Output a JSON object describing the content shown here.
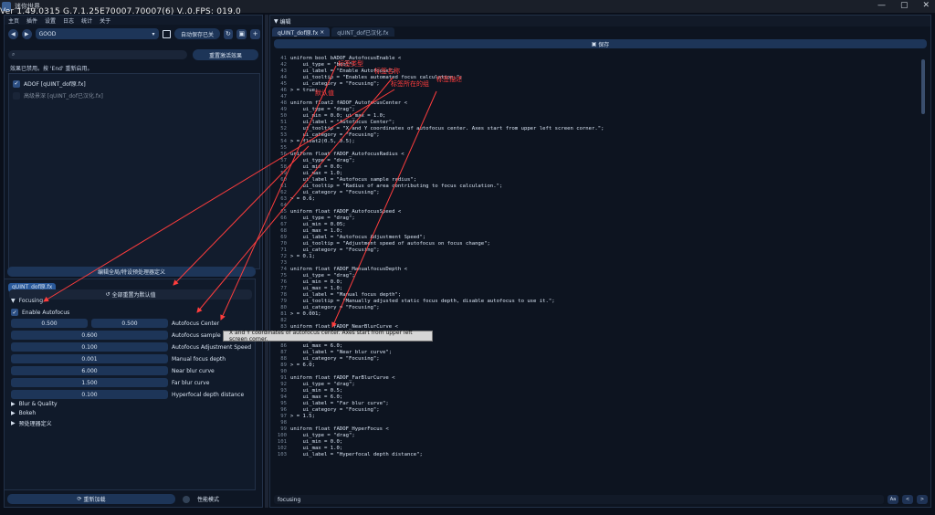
{
  "window": {
    "title": "迷你世界",
    "version_overlay": "Ver 1.49.0315 G.7.1.25E70007.70007(6) V..0.FPS: 019.0"
  },
  "left": {
    "menu": [
      "主页",
      "插件",
      "设置",
      "日志",
      "统计",
      "关于"
    ],
    "preset": {
      "value": "GOOD"
    },
    "autosave_label": "自动保存已关",
    "search_placeholder": "",
    "rearrange_label": "重置激活效果",
    "hint": "效果已禁用。按 'End' 重新启用。",
    "effects": [
      {
        "label": "ADOF [qUINT_dof原.fx]",
        "checked": true
      },
      {
        "label": "高级景深 [qUINT_dof已汉化.fx]",
        "checked": false
      }
    ],
    "editor_toggle_label": "编辑全局/特设预处理器定义",
    "param_tab": "qUINT_dof原.fx",
    "reset_all_label": "全部重置为默认值",
    "sections": {
      "focusing": "Focusing",
      "enable_autofocus": "Enable Autofocus",
      "blur_quality": "Blur & Quality",
      "bokeh": "Bokeh",
      "preprocessor": "预处理器定义"
    },
    "params": [
      {
        "label": "Autofocus Center",
        "values": [
          "0.500",
          "0.500"
        ]
      },
      {
        "label": "Autofocus sample radius",
        "values": [
          "0.600"
        ]
      },
      {
        "label": "Autofocus Adjustment Speed",
        "values": [
          "0.100"
        ]
      },
      {
        "label": "Manual focus depth",
        "values": [
          "0.001"
        ]
      },
      {
        "label": "Near blur curve",
        "values": [
          "6.000"
        ]
      },
      {
        "label": "Far blur curve",
        "values": [
          "1.500"
        ]
      },
      {
        "label": "Hyperfocal depth distance",
        "values": [
          "0.100"
        ]
      }
    ],
    "reload_label": "重新加载",
    "perf_mode_label": "性能模式"
  },
  "right": {
    "title": "编辑",
    "tabs": [
      "qUINT_dof原.fx",
      "qUINT_dof已汉化.fx"
    ],
    "save_label": "保存",
    "find_value": "focusing",
    "find_buttons": [
      "Aa",
      "<",
      ">"
    ]
  },
  "code_lines": [
    {
      "n": "41",
      "t": "uniform bool bADOF_AutofocusEnable <"
    },
    {
      "n": "42",
      "t": "    ui_type = \"bool\";"
    },
    {
      "n": "43",
      "t": "    ui_label = \"Enable Autofocus\";"
    },
    {
      "n": "44",
      "t": "    ui_tooltip = \"Enables automated focus calculation.\";"
    },
    {
      "n": "45",
      "t": "    ui_category = \"Focusing\";"
    },
    {
      "n": "46",
      "t": "> = true;"
    },
    {
      "n": "47",
      "t": ""
    },
    {
      "n": "48",
      "t": "uniform float2 fADOF_AutofocusCenter <"
    },
    {
      "n": "49",
      "t": "    ui_type = \"drag\";"
    },
    {
      "n": "50",
      "t": "    ui_min = 0.0; ui_max = 1.0;"
    },
    {
      "n": "51",
      "t": "    ui_label = \"Autofocus Center\";"
    },
    {
      "n": "52",
      "t": "    ui_tooltip = \"X and Y coordinates of autofocus center. Axes start from upper left screen corner.\";"
    },
    {
      "n": "53",
      "t": "    ui_category = \"Focusing\";"
    },
    {
      "n": "54",
      "t": "> = float2(0.5, 0.5);"
    },
    {
      "n": "55",
      "t": ""
    },
    {
      "n": "56",
      "t": "uniform float fADOF_AutofocusRadius <"
    },
    {
      "n": "57",
      "t": "    ui_type = \"drag\";"
    },
    {
      "n": "58",
      "t": "    ui_min = 0.0;"
    },
    {
      "n": "59",
      "t": "    ui_max = 1.0;"
    },
    {
      "n": "60",
      "t": "    ui_label = \"Autofocus sample radius\";"
    },
    {
      "n": "61",
      "t": "    ui_tooltip = \"Radius of area contributing to focus calculation.\";"
    },
    {
      "n": "62",
      "t": "    ui_category = \"Focusing\";"
    },
    {
      "n": "63",
      "t": "> = 0.6;"
    },
    {
      "n": "64",
      "t": ""
    },
    {
      "n": "65",
      "t": "uniform float fADOF_AutofocusSpeed <"
    },
    {
      "n": "66",
      "t": "    ui_type = \"drag\";"
    },
    {
      "n": "67",
      "t": "    ui_min = 0.05;"
    },
    {
      "n": "68",
      "t": "    ui_max = 1.0;"
    },
    {
      "n": "69",
      "t": "    ui_label = \"Autofocus Adjustment Speed\";"
    },
    {
      "n": "70",
      "t": "    ui_tooltip = \"Adjustment speed of autofocus on focus change\";"
    },
    {
      "n": "71",
      "t": "    ui_category = \"Focusing\";"
    },
    {
      "n": "72",
      "t": "> = 0.1;"
    },
    {
      "n": "73",
      "t": ""
    },
    {
      "n": "74",
      "t": "uniform float fADOF_ManualfocusDepth <"
    },
    {
      "n": "75",
      "t": "    ui_type = \"drag\";"
    },
    {
      "n": "76",
      "t": "    ui_min = 0.0;"
    },
    {
      "n": "77",
      "t": "    ui_max = 1.0;"
    },
    {
      "n": "78",
      "t": "    ui_label = \"Manual focus depth\";"
    },
    {
      "n": "79",
      "t": "    ui_tooltip = \"Manually adjusted static focus depth, disable autofocus to use it.\";"
    },
    {
      "n": "80",
      "t": "    ui_category = \"Focusing\";"
    },
    {
      "n": "81",
      "t": "> = 0.001;"
    },
    {
      "n": "82",
      "t": ""
    },
    {
      "n": "83",
      "t": "uniform float fADOF_NearBlurCurve <"
    },
    {
      "n": "84",
      "t": "    ui_type = \"drag\";"
    },
    {
      "n": "85",
      "t": "    ui_min = 0.5;"
    },
    {
      "n": "86",
      "t": "    ui_max = 6.0;"
    },
    {
      "n": "87",
      "t": "    ui_label = \"Near blur curve\";"
    },
    {
      "n": "88",
      "t": "    ui_category = \"Focusing\";"
    },
    {
      "n": "89",
      "t": "> = 6.0;"
    },
    {
      "n": "90",
      "t": ""
    },
    {
      "n": "91",
      "t": "uniform float fADOF_FarBlurCurve <"
    },
    {
      "n": "92",
      "t": "    ui_type = \"drag\";"
    },
    {
      "n": "93",
      "t": "    ui_min = 0.5;"
    },
    {
      "n": "94",
      "t": "    ui_max = 6.0;"
    },
    {
      "n": "95",
      "t": "    ui_label = \"Far blur curve\";"
    },
    {
      "n": "96",
      "t": "    ui_category = \"Focusing\";"
    },
    {
      "n": "97",
      "t": "> = 1.5;"
    },
    {
      "n": "98",
      "t": ""
    },
    {
      "n": "99",
      "t": "uniform float fADOF_HyperFocus <"
    },
    {
      "n": "100",
      "t": "    ui_type = \"drag\";"
    },
    {
      "n": "101",
      "t": "    ui_min = 0.0;"
    },
    {
      "n": "102",
      "t": "    ui_max = 1.0;"
    },
    {
      "n": "103",
      "t": "    ui_label = \"Hyperfocal depth distance\";"
    }
  ],
  "tooltip": "X and Y coordinates of autofocus center. Axes start from upper left screen corner.",
  "annotations": {
    "type": "标签类型",
    "name": "标签名称",
    "group": "标签所在的组",
    "default": "默认值",
    "desc": "标签描述"
  },
  "colors": {
    "annotation_red": "#ff3d3d",
    "accent_blue": "#2a5a9b"
  }
}
